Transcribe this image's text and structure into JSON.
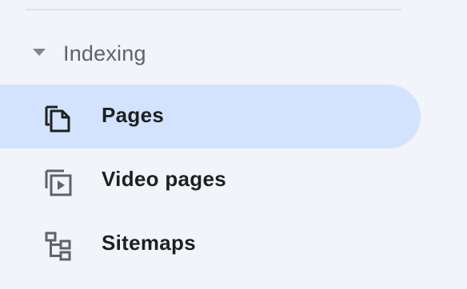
{
  "sidebar": {
    "section": {
      "label": "Indexing",
      "expanded": true,
      "icon": "caret-down-icon"
    },
    "items": [
      {
        "label": "Pages",
        "icon": "pages-icon",
        "active": true
      },
      {
        "label": "Video pages",
        "icon": "video-pages-icon",
        "active": false
      },
      {
        "label": "Sitemaps",
        "icon": "sitemaps-icon",
        "active": false
      }
    ]
  },
  "colors": {
    "background": "#f1f4f9",
    "active_item": "#d3e3fd",
    "text_primary": "#1f1f1f",
    "text_secondary": "#5f6368",
    "icon": "#444746"
  }
}
